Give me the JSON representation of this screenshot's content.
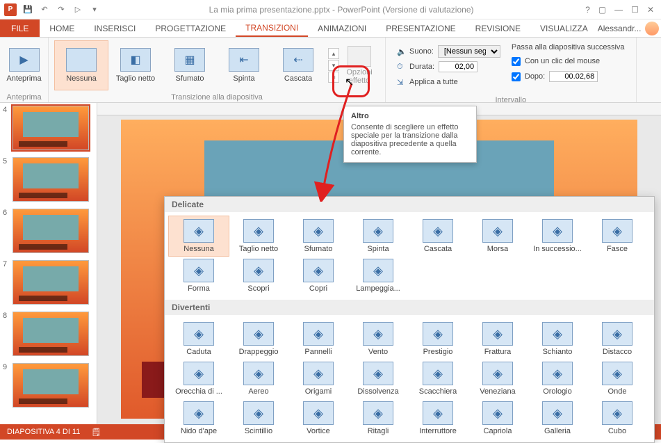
{
  "titlebar": {
    "title": "La mia prima presentazione.pptx - PowerPoint (Versione di valutazione)"
  },
  "tabs": {
    "file": "FILE",
    "items": [
      "HOME",
      "INSERISCI",
      "PROGETTAZIONE",
      "TRANSIZIONI",
      "ANIMAZIONI",
      "PRESENTAZIONE",
      "REVISIONE",
      "VISUALIZZA"
    ],
    "active_index": 3,
    "user": "Alessandr..."
  },
  "ribbon": {
    "anteprima_group": {
      "button": "Anteprima",
      "label": "Anteprima"
    },
    "transitions_group_label": "Transizione alla diapositiva",
    "gallery": [
      {
        "name": "Nessuna"
      },
      {
        "name": "Taglio netto"
      },
      {
        "name": "Sfumato"
      },
      {
        "name": "Spinta"
      },
      {
        "name": "Cascata"
      }
    ],
    "opzioni_label": "Opzioni effetto",
    "timing": {
      "suono_label": "Suono:",
      "suono_value": "[Nessun seg...",
      "durata_label": "Durata:",
      "durata_value": "02,00",
      "applica_label": "Applica a tutte"
    },
    "advance": {
      "header": "Passa alla diapositiva successiva",
      "onclick_label": "Con un clic del mouse",
      "onclick_checked": true,
      "after_label": "Dopo:",
      "after_checked": true,
      "after_value": "00.02,68"
    },
    "intervallo_label": "Intervallo"
  },
  "thumbs": {
    "start": 4,
    "count": 6,
    "selected": 4
  },
  "tooltip": {
    "title": "Altro",
    "body": "Consente di scegliere un effetto speciale per la transizione dalla diapositiva precedente a quella corrente."
  },
  "gallery_drop": {
    "sections": [
      {
        "name": "Delicate",
        "items": [
          "Nessuna",
          "Taglio netto",
          "Sfumato",
          "Spinta",
          "Cascata",
          "Morsa",
          "In successio...",
          "Fasce",
          "Forma",
          "Scopri",
          "Copri",
          "Lampeggia..."
        ],
        "selected_index": 0
      },
      {
        "name": "Divertenti",
        "items": [
          "Caduta",
          "Drappeggio",
          "Pannelli",
          "Vento",
          "Prestigio",
          "Frattura",
          "Schianto",
          "Distacco",
          "Orecchia di ...",
          "Aereo",
          "Origami",
          "Dissolvenza",
          "Scacchiera",
          "Veneziana",
          "Orologio",
          "Onde",
          "Nido d'ape",
          "Scintillio",
          "Vortice",
          "Ritagli",
          "Interruttore",
          "Capriola",
          "Galleria",
          "Cubo"
        ]
      }
    ]
  },
  "statusbar": {
    "slide": "DIAPOSITIVA 4 DI 11"
  }
}
